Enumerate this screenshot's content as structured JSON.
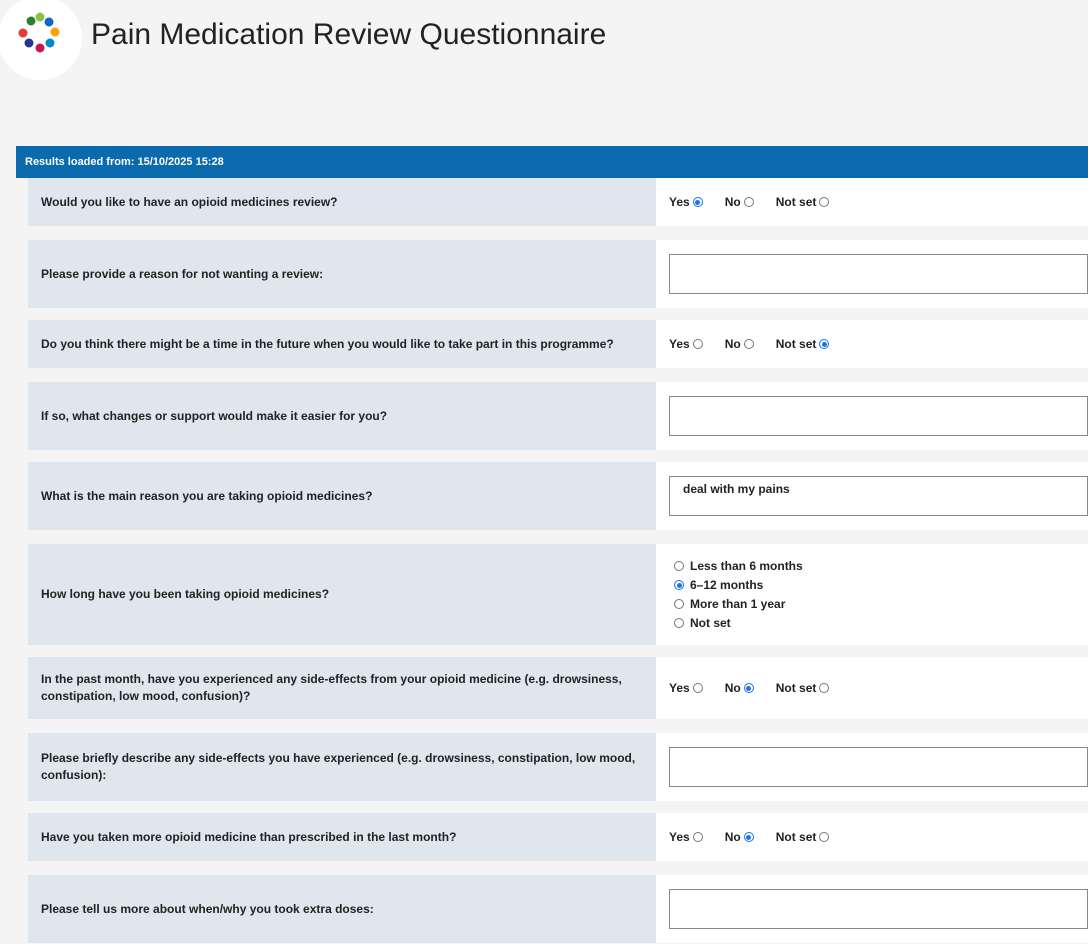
{
  "header": {
    "title": "Pain Medication Review Questionnaire",
    "logo_colors": [
      "#2e7d32",
      "#8bc34a",
      "#1565c0",
      "#ffa000",
      "#ab47bc",
      "#e53935",
      "#283593",
      "#0288d1",
      "#c2185b"
    ]
  },
  "results_bar": {
    "text": "Results loaded from: 15/10/2025 15:28"
  },
  "questions": [
    {
      "label": "Would you like to have an opioid medicines review?",
      "type": "yesno",
      "options": [
        "Yes",
        "No",
        "Not set"
      ],
      "selected": "Yes"
    },
    {
      "label": "Please provide a reason for not wanting a review:",
      "type": "text",
      "value": ""
    },
    {
      "label": "Do you think there might be a time in the future when you would like to take part in this programme?",
      "type": "yesno",
      "options": [
        "Yes",
        "No",
        "Not set"
      ],
      "selected": "Not set"
    },
    {
      "label": "If so, what changes or support would make it easier for you?",
      "type": "text",
      "value": ""
    },
    {
      "label": "What is the main reason you are taking opioid medicines?",
      "type": "text",
      "value": "deal with my pains"
    },
    {
      "label": "How long have you been taking opioid medicines?",
      "type": "vradio",
      "options": [
        "Less than 6 months",
        "6–12 months",
        "More than 1 year",
        "Not set"
      ],
      "selected": "6–12 months"
    },
    {
      "label": "In the past month, have you experienced any side-effects from your opioid medicine (e.g. drowsiness, constipation, low mood, confusion)?",
      "type": "yesno",
      "options": [
        "Yes",
        "No",
        "Not set"
      ],
      "selected": "No"
    },
    {
      "label": "Please briefly describe any side-effects you have experienced (e.g. drowsiness, constipation, low mood, confusion):",
      "type": "text",
      "value": ""
    },
    {
      "label": "Have you taken more opioid medicine than prescribed in the last month?",
      "type": "yesno",
      "options": [
        "Yes",
        "No",
        "Not set"
      ],
      "selected": "No"
    },
    {
      "label": "Please tell us more about when/why you took extra doses:",
      "type": "text",
      "value": ""
    }
  ]
}
